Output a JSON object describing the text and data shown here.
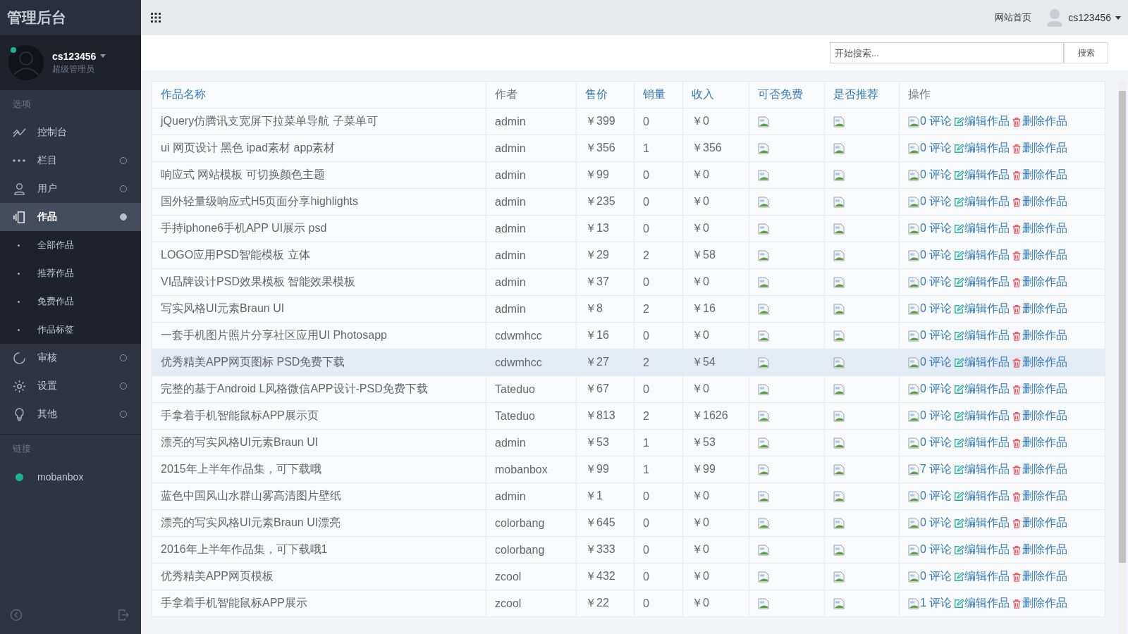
{
  "brand": "管理后台",
  "profile": {
    "name": "cs123456",
    "role": "超级管理员",
    "online": true
  },
  "nav_sections": [
    {
      "title": "选项",
      "items": [
        {
          "label": "控制台",
          "kind": "plain",
          "selected": false
        },
        {
          "label": "栏目",
          "kind": "group",
          "selected": false,
          "expanded": false
        },
        {
          "label": "用户",
          "kind": "group",
          "selected": false,
          "expanded": false
        },
        {
          "label": "作品",
          "kind": "group",
          "selected": true,
          "expanded": true,
          "children": [
            {
              "label": "全部作品"
            },
            {
              "label": "推荐作品"
            },
            {
              "label": "免费作品"
            },
            {
              "label": "作品标签"
            }
          ]
        },
        {
          "label": "审核",
          "kind": "group",
          "selected": false,
          "expanded": false
        },
        {
          "label": "设置",
          "kind": "group",
          "selected": false,
          "expanded": false
        },
        {
          "label": "其他",
          "kind": "group",
          "selected": false,
          "expanded": false
        }
      ]
    },
    {
      "title": "链接",
      "items": [
        {
          "label": "mobanbox",
          "kind": "link",
          "color": "#1ab394",
          "selected": false
        }
      ]
    }
  ],
  "topbar": {
    "home_link": "网站首页",
    "user": "cs123456"
  },
  "search": {
    "placeholder": "开始搜索...",
    "button": "搜索"
  },
  "table": {
    "columns": [
      "作品名称",
      "作者",
      "售价",
      "销量",
      "收入",
      "可否免费",
      "是否推荐",
      "操作"
    ],
    "column_link": [
      true,
      false,
      true,
      true,
      true,
      true,
      true,
      false
    ],
    "rows": [
      {
        "name": "jQuery仿腾讯支宽屏下拉菜单导航 子菜单可",
        "author": "admin",
        "price": "￥399",
        "sales": "0",
        "income": "￥0",
        "comments": "0 评论",
        "edit": "编辑作品",
        "delete": "删除作品",
        "selected": false
      },
      {
        "name": "ui 网页设计 黑色 ipad素材 app素材",
        "author": "admin",
        "price": "￥356",
        "sales": "1",
        "income": "￥356",
        "comments": "0 评论",
        "edit": "编辑作品",
        "delete": "删除作品",
        "selected": false
      },
      {
        "name": "响应式 网站模板 可切换颜色主题",
        "author": "admin",
        "price": "￥99",
        "sales": "0",
        "income": "￥0",
        "comments": "0 评论",
        "edit": "编辑作品",
        "delete": "删除作品",
        "selected": false
      },
      {
        "name": "国外轻量级响应式H5页面分享highlights",
        "author": "admin",
        "price": "￥235",
        "sales": "0",
        "income": "￥0",
        "comments": "0 评论",
        "edit": "编辑作品",
        "delete": "删除作品",
        "selected": false
      },
      {
        "name": "手持iphone6手机APP UI展示 psd",
        "author": "admin",
        "price": "￥13",
        "sales": "0",
        "income": "￥0",
        "comments": "0 评论",
        "edit": "编辑作品",
        "delete": "删除作品",
        "selected": false
      },
      {
        "name": "LOGO应用PSD智能模板 立体",
        "author": "admin",
        "price": "￥29",
        "sales": "2",
        "income": "￥58",
        "comments": "0 评论",
        "edit": "编辑作品",
        "delete": "删除作品",
        "selected": false
      },
      {
        "name": "VI品牌设计PSD效果模板 智能效果模板",
        "author": "admin",
        "price": "￥37",
        "sales": "0",
        "income": "￥0",
        "comments": "0 评论",
        "edit": "编辑作品",
        "delete": "删除作品",
        "selected": false
      },
      {
        "name": "写实风格UI元素Braun UI",
        "author": "admin",
        "price": "￥8",
        "sales": "2",
        "income": "￥16",
        "comments": "0 评论",
        "edit": "编辑作品",
        "delete": "删除作品",
        "selected": false
      },
      {
        "name": "一套手机图片照片分享社区应用UI Photosapp",
        "author": "cdwmhcc",
        "price": "￥16",
        "sales": "0",
        "income": "￥0",
        "comments": "0 评论",
        "edit": "编辑作品",
        "delete": "删除作品",
        "selected": false
      },
      {
        "name": "优秀精美APP网页图标 PSD免费下载",
        "author": "cdwmhcc",
        "price": "￥27",
        "sales": "2",
        "income": "￥54",
        "comments": "0 评论",
        "edit": "编辑作品",
        "delete": "删除作品",
        "selected": true
      },
      {
        "name": "完整的基于Android L风格微信APP设计-PSD免费下载",
        "author": "Tateduo",
        "price": "￥67",
        "sales": "0",
        "income": "￥0",
        "comments": "0 评论",
        "edit": "编辑作品",
        "delete": "删除作品",
        "selected": false
      },
      {
        "name": "手拿着手机智能鼠标APP展示页",
        "author": "Tateduo",
        "price": "￥813",
        "sales": "2",
        "income": "￥1626",
        "comments": "0 评论",
        "edit": "编辑作品",
        "delete": "删除作品",
        "selected": false
      },
      {
        "name": "漂亮的写实风格UI元素Braun UI",
        "author": "admin",
        "price": "￥53",
        "sales": "1",
        "income": "￥53",
        "comments": "0 评论",
        "edit": "编辑作品",
        "delete": "删除作品",
        "selected": false
      },
      {
        "name": "2015年上半年作品集，可下载哦",
        "author": "mobanbox",
        "price": "￥99",
        "sales": "1",
        "income": "￥99",
        "comments": "7 评论",
        "edit": "编辑作品",
        "delete": "删除作品",
        "selected": false
      },
      {
        "name": "蓝色中国风山水群山雾高清图片壁纸",
        "author": "admin",
        "price": "￥1",
        "sales": "0",
        "income": "￥0",
        "comments": "0 评论",
        "edit": "编辑作品",
        "delete": "删除作品",
        "selected": false
      },
      {
        "name": "漂亮的写实风格UI元素Braun UI漂亮",
        "author": "colorbang",
        "price": "￥645",
        "sales": "0",
        "income": "￥0",
        "comments": "0 评论",
        "edit": "编辑作品",
        "delete": "删除作品",
        "selected": false
      },
      {
        "name": "2016年上半年作品集，可下载哦1",
        "author": "colorbang",
        "price": "￥333",
        "sales": "0",
        "income": "￥0",
        "comments": "0 评论",
        "edit": "编辑作品",
        "delete": "删除作品",
        "selected": false
      },
      {
        "name": "优秀精美APP网页模板",
        "author": "zcool",
        "price": "￥432",
        "sales": "0",
        "income": "￥0",
        "comments": "0 评论",
        "edit": "编辑作品",
        "delete": "删除作品",
        "selected": false
      },
      {
        "name": "手拿着手机智能鼠标APP展示",
        "author": "zcool",
        "price": "￥22",
        "sales": "0",
        "income": "￥0",
        "comments": "1 评论",
        "edit": "编辑作品",
        "delete": "删除作品",
        "selected": false
      }
    ]
  }
}
